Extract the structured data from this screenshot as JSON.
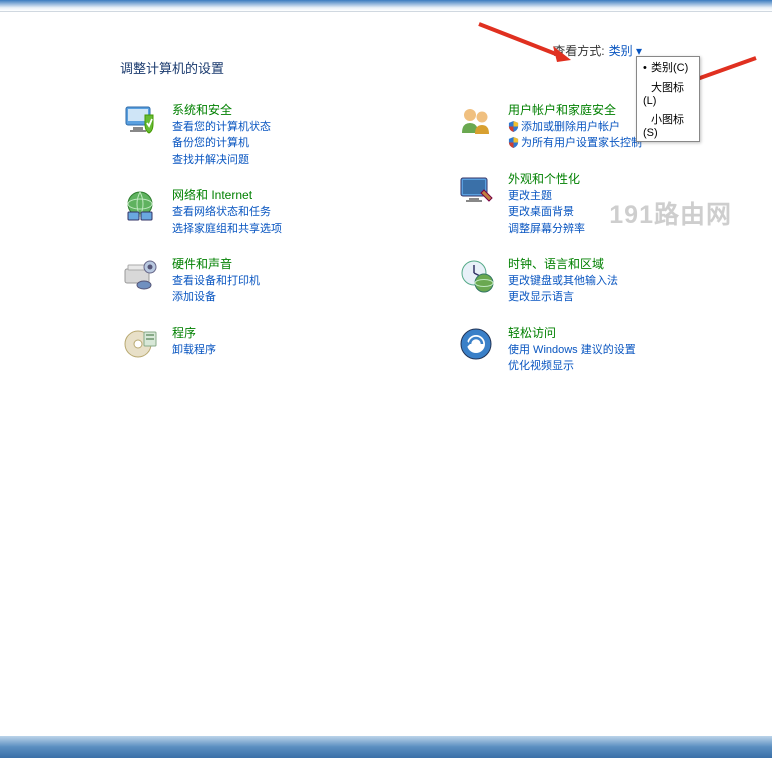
{
  "page_title": "调整计算机的设置",
  "view_by_label": "查看方式:",
  "view_by_value": "类别 ▾",
  "dropdown": {
    "option1": "类别(C)",
    "option2": "大图标(L)",
    "option3": "小图标(S)"
  },
  "watermark": "191路由网",
  "left": {
    "system": {
      "title": "系统和安全",
      "l1": "查看您的计算机状态",
      "l2": "备份您的计算机",
      "l3": "查找并解决问题"
    },
    "network": {
      "title": "网络和 Internet",
      "l1": "查看网络状态和任务",
      "l2": "选择家庭组和共享选项"
    },
    "hardware": {
      "title": "硬件和声音",
      "l1": "查看设备和打印机",
      "l2": "添加设备"
    },
    "programs": {
      "title": "程序",
      "l1": "卸载程序"
    }
  },
  "right": {
    "users": {
      "title": "用户帐户和家庭安全",
      "l1": "添加或删除用户帐户",
      "l2": "为所有用户设置家长控制"
    },
    "appearance": {
      "title": "外观和个性化",
      "l1": "更改主题",
      "l2": "更改桌面背景",
      "l3": "调整屏幕分辨率"
    },
    "clock": {
      "title": "时钟、语言和区域",
      "l1": "更改键盘或其他输入法",
      "l2": "更改显示语言"
    },
    "ease": {
      "title": "轻松访问",
      "l1": "使用 Windows 建议的设置",
      "l2": "优化视频显示"
    }
  }
}
